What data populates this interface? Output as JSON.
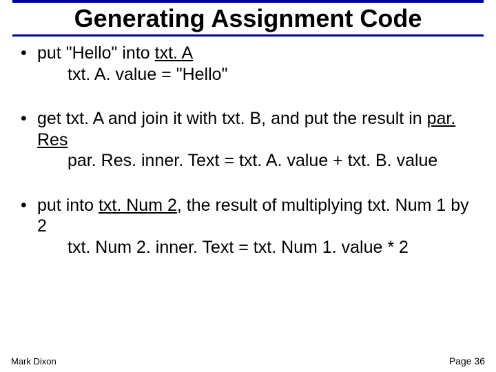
{
  "title": "Generating Assignment Code",
  "bullets": [
    {
      "line1a": "put \"Hello\" into ",
      "line1b": "txt. A",
      "sub": "txt. A. value = \"Hello\""
    },
    {
      "line1a": "get txt. A and join it with txt. B, and put the result in ",
      "line1b": "par. Res",
      "sub": "par. Res. inner. Text = txt. A. value + txt. B. value"
    },
    {
      "line1a": "put into ",
      "line1b": "txt. Num 2",
      "line1c": ", the result of multiplying txt. Num 1 by 2",
      "sub": "txt. Num 2. inner. Text = txt. Num 1. value * 2"
    }
  ],
  "footer": {
    "author": "Mark Dixon",
    "page": "Page 36"
  },
  "dot": "•"
}
